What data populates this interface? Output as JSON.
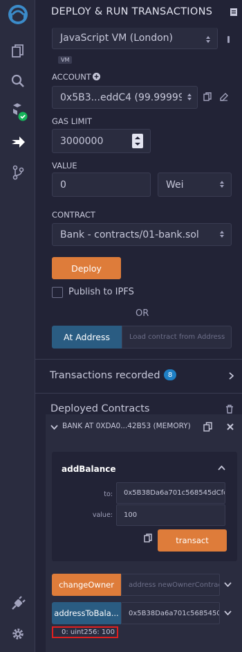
{
  "header": {
    "title": "DEPLOY & RUN TRANSACTIONS"
  },
  "environment": {
    "value": "JavaScript VM (London)",
    "badge": "VM"
  },
  "account": {
    "label": "ACCOUNT",
    "value": "0x5B3...eddC4 (99.999999"
  },
  "gas_limit": {
    "label": "GAS LIMIT",
    "value": "3000000"
  },
  "value_field": {
    "label": "VALUE",
    "amount": "0",
    "unit": "Wei"
  },
  "contract": {
    "label": "CONTRACT",
    "value": "Bank - contracts/01-bank.sol"
  },
  "deploy": {
    "label": "Deploy",
    "publish_label": "Publish to IPFS",
    "or": "OR"
  },
  "at_address": {
    "label": "At Address",
    "placeholder": "Load contract from Address"
  },
  "transactions": {
    "label": "Transactions recorded",
    "count": "8"
  },
  "deployed": {
    "title": "Deployed Contracts",
    "instance_title": "BANK AT 0XDA0...42B53 (MEMORY)",
    "add_balance": {
      "title": "addBalance",
      "to_label": "to:",
      "to_value": "0x5B38Da6a701c568545dCfc",
      "value_label": "value:",
      "value_value": "100",
      "transact_label": "transact"
    },
    "change_owner": {
      "label": "changeOwner",
      "placeholder": "address newOwnerContract"
    },
    "address_to_balance": {
      "label": "addressToBala...",
      "input_value": "0x5B38Da6a701c5685450",
      "result": "0: uint256: 100"
    }
  },
  "colors": {
    "background": "#222336",
    "sidebar": "#2a2c3f",
    "accent_orange": "#de7c3a",
    "accent_blue": "#2a5c82",
    "badge_blue": "#1e7fc4",
    "highlight_red": "#e02020",
    "success_green": "#16b45a"
  },
  "icons": [
    "remix-logo-icon",
    "file-explorer-icon",
    "search-icon",
    "compiler-icon",
    "deploy-icon",
    "git-icon",
    "plugin-icon",
    "settings-icon"
  ]
}
